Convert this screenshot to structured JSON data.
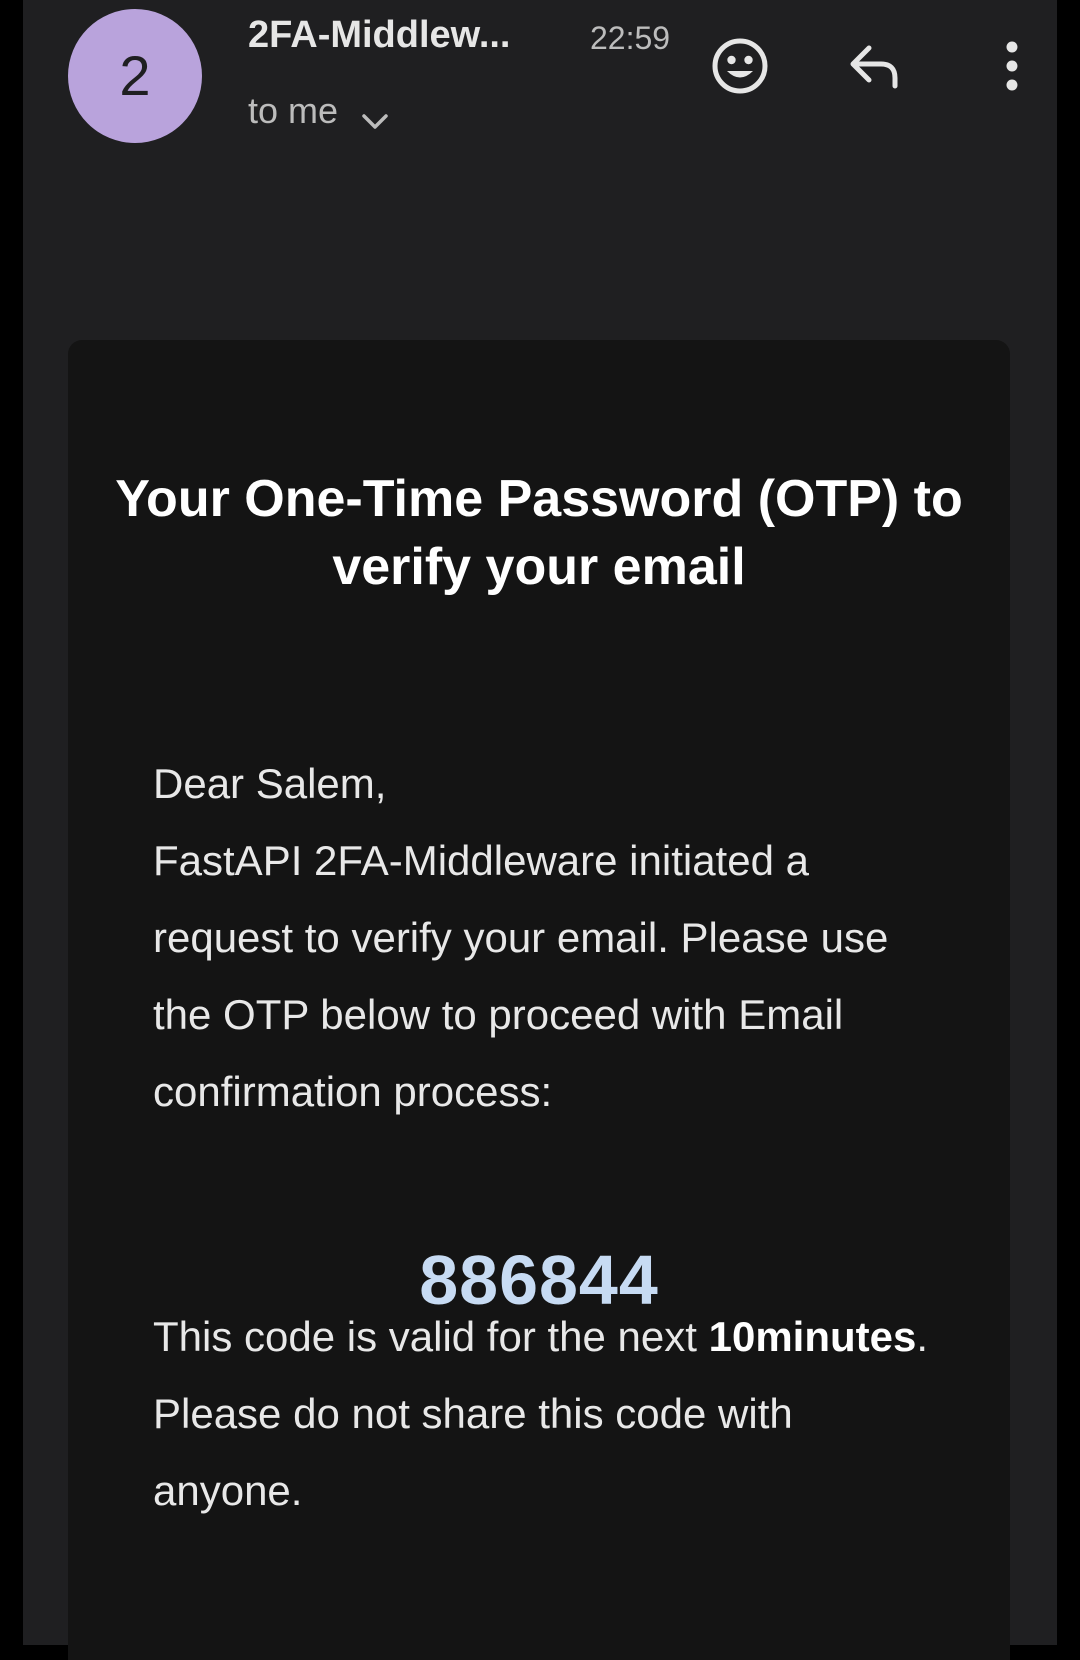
{
  "header": {
    "avatar_letter": "2",
    "sender": "2FA-Middlew...",
    "time": "22:59",
    "recipient": "to me",
    "icons": {
      "avatar": "avatar",
      "chevron": "chevron-down-icon",
      "emoji": "emoji-reaction-icon",
      "reply": "reply-icon",
      "more": "more-vertical-icon"
    }
  },
  "email": {
    "title": "Your One-Time Password (OTP) to verify your email",
    "greeting": "Dear Salem,",
    "body": "FastAPI 2FA-Middleware initiated a request to verify your email. Please use the OTP below to proceed with Email confirmation process:",
    "otp": "886844",
    "validity_prefix": "This code is valid for the next ",
    "validity_duration": "10minutes",
    "validity_suffix": ". Please do not share this code with anyone."
  },
  "colors": {
    "background": "#1f1f21",
    "card": "#141414",
    "avatar": "#b9a3dc",
    "otp": "#c7dbf3"
  }
}
